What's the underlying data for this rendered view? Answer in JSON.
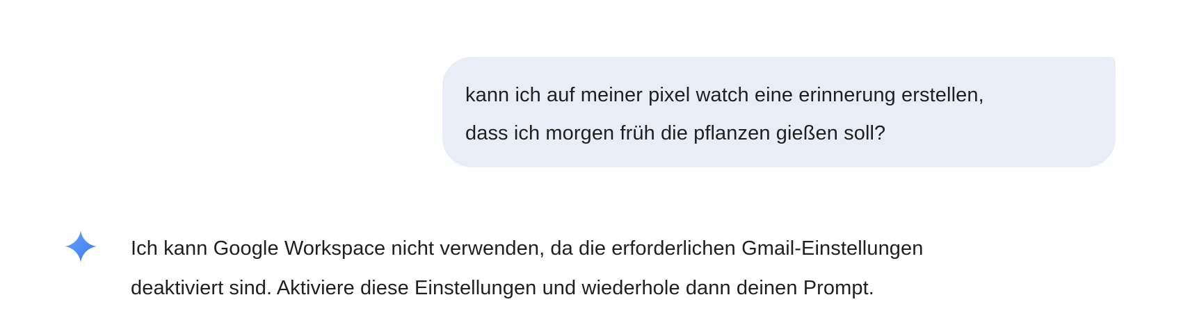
{
  "user_message": {
    "lines": [
      "kann ich auf meiner pixel watch eine erinnerung erstellen,",
      "dass ich morgen früh die pflanzen gießen soll?"
    ]
  },
  "assistant_message": {
    "icon": "gemini-sparkle-icon",
    "lines": [
      "Ich kann Google Workspace nicht verwenden, da die erforderlichen Gmail-Einstellungen",
      "deaktiviert sind. Aktiviere diese Einstellungen und wiederhole dann deinen Prompt."
    ]
  },
  "colors": {
    "user_bubble_bg": "#e9eef6",
    "text": "#1f1f1f",
    "icon_gradient_start": "#4f8df5",
    "icon_gradient_end": "#3a6fe0"
  }
}
